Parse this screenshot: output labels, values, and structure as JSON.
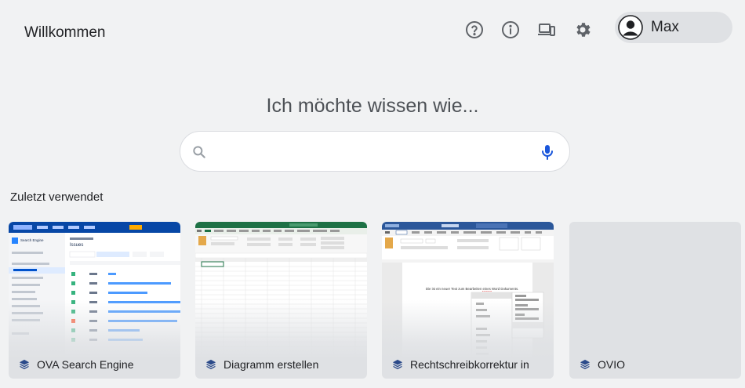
{
  "header": {
    "title": "Willkommen",
    "icons": [
      "help-icon",
      "info-icon",
      "devices-icon",
      "gear-icon"
    ],
    "user": {
      "name": "Max"
    }
  },
  "main": {
    "headline": "Ich möchte wissen wie...",
    "search": {
      "value": "",
      "placeholder": ""
    }
  },
  "recent": {
    "label": "Zuletzt verwendet",
    "cards": [
      {
        "title": "OVA Search Engine",
        "thumb": "jira-issues-screenshot",
        "thumb_text": {
          "project": "Search Engine",
          "section": "Issues"
        }
      },
      {
        "title": "Diagramm erstellen",
        "thumb": "excel-sheet-screenshot"
      },
      {
        "title": "Rechtschreibkorrektur in",
        "thumb": "word-document-screenshot",
        "thumb_text": {
          "sentence": "Die ist ein neuer Text zum Bearbeiten eines Word Dokuments."
        }
      },
      {
        "title": "OVIO",
        "thumb": ""
      }
    ]
  },
  "colors": {
    "background": "#f1f2f3",
    "profile_pill": "#dfe1e4",
    "mic": "#1a56db",
    "card_icon": "#2b4a8a"
  }
}
